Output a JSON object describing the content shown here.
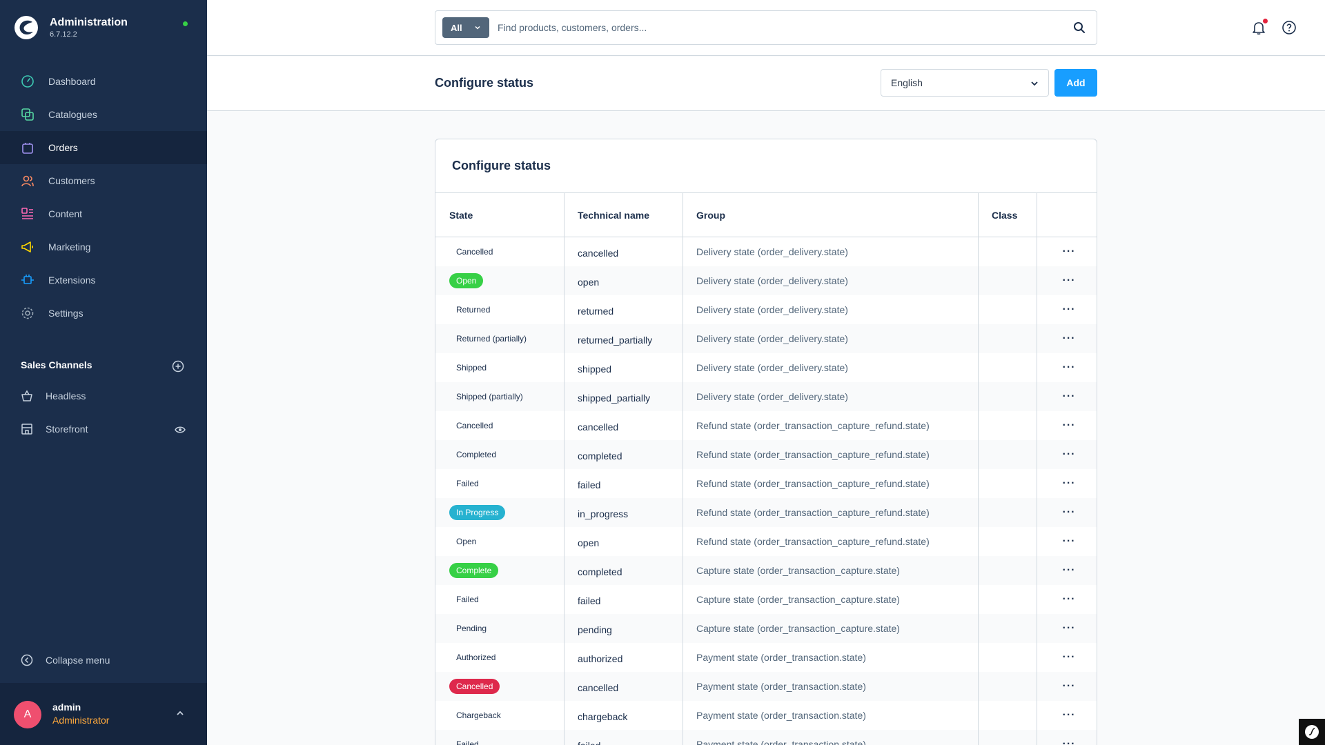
{
  "app": {
    "title": "Administration",
    "version": "6.7.12.2"
  },
  "nav": [
    {
      "label": "Dashboard",
      "icon": "dashboard-icon",
      "color": "#3ecbb4"
    },
    {
      "label": "Catalogues",
      "icon": "catalogue-icon",
      "color": "#57d9a3"
    },
    {
      "label": "Orders",
      "icon": "orders-icon",
      "color": "#a092f0"
    },
    {
      "label": "Customers",
      "icon": "customers-icon",
      "color": "#f88962"
    },
    {
      "label": "Content",
      "icon": "content-icon",
      "color": "#ff68b4"
    },
    {
      "label": "Marketing",
      "icon": "marketing-icon",
      "color": "#ffd700"
    },
    {
      "label": "Extensions",
      "icon": "extensions-icon",
      "color": "#189eff"
    },
    {
      "label": "Settings",
      "icon": "settings-icon",
      "color": "#9aa8b5"
    }
  ],
  "sales_channels": {
    "title": "Sales Channels",
    "items": [
      {
        "label": "Headless"
      },
      {
        "label": "Storefront"
      }
    ]
  },
  "collapse_label": "Collapse menu",
  "user": {
    "initial": "A",
    "name": "admin",
    "role": "Administrator"
  },
  "search": {
    "type_label": "All",
    "placeholder": "Find products, customers, orders..."
  },
  "smartbar": {
    "title": "Configure status",
    "language": "English",
    "add_label": "Add"
  },
  "card": {
    "title": "Configure status",
    "columns": [
      "State",
      "Technical name",
      "Group",
      "Class"
    ],
    "rows": [
      {
        "state": "Cancelled",
        "badge": "",
        "tech": "cancelled",
        "group": "Delivery state (order_delivery.state)"
      },
      {
        "state": "Open",
        "badge": "#37d046",
        "tech": "open",
        "group": "Delivery state (order_delivery.state)"
      },
      {
        "state": "Returned",
        "badge": "",
        "tech": "returned",
        "group": "Delivery state (order_delivery.state)"
      },
      {
        "state": "Returned (partially)",
        "badge": "",
        "tech": "returned_partially",
        "group": "Delivery state (order_delivery.state)"
      },
      {
        "state": "Shipped",
        "badge": "",
        "tech": "shipped",
        "group": "Delivery state (order_delivery.state)"
      },
      {
        "state": "Shipped (partially)",
        "badge": "",
        "tech": "shipped_partially",
        "group": "Delivery state (order_delivery.state)"
      },
      {
        "state": "Cancelled",
        "badge": "",
        "tech": "cancelled",
        "group": "Refund state (order_transaction_capture_refund.state)"
      },
      {
        "state": "Completed",
        "badge": "",
        "tech": "completed",
        "group": "Refund state (order_transaction_capture_refund.state)"
      },
      {
        "state": "Failed",
        "badge": "",
        "tech": "failed",
        "group": "Refund state (order_transaction_capture_refund.state)"
      },
      {
        "state": "In Progress",
        "badge": "#26b2d0",
        "tech": "in_progress",
        "group": "Refund state (order_transaction_capture_refund.state)"
      },
      {
        "state": "Open",
        "badge": "",
        "tech": "open",
        "group": "Refund state (order_transaction_capture_refund.state)"
      },
      {
        "state": "Complete",
        "badge": "#37d046",
        "tech": "completed",
        "group": "Capture state (order_transaction_capture.state)"
      },
      {
        "state": "Failed",
        "badge": "",
        "tech": "failed",
        "group": "Capture state (order_transaction_capture.state)"
      },
      {
        "state": "Pending",
        "badge": "",
        "tech": "pending",
        "group": "Capture state (order_transaction_capture.state)"
      },
      {
        "state": "Authorized",
        "badge": "",
        "tech": "authorized",
        "group": "Payment state (order_transaction.state)"
      },
      {
        "state": "Cancelled",
        "badge": "#de294c",
        "tech": "cancelled",
        "group": "Payment state (order_transaction.state)"
      },
      {
        "state": "Chargeback",
        "badge": "",
        "tech": "chargeback",
        "group": "Payment state (order_transaction.state)"
      },
      {
        "state": "Failed",
        "badge": "",
        "tech": "failed",
        "group": "Payment state (order_transaction.state)"
      }
    ],
    "actions_label": "···"
  },
  "colors": {
    "sidebar": "#1b2e4b",
    "primary": "#189eff",
    "role": "#ffa93c"
  }
}
